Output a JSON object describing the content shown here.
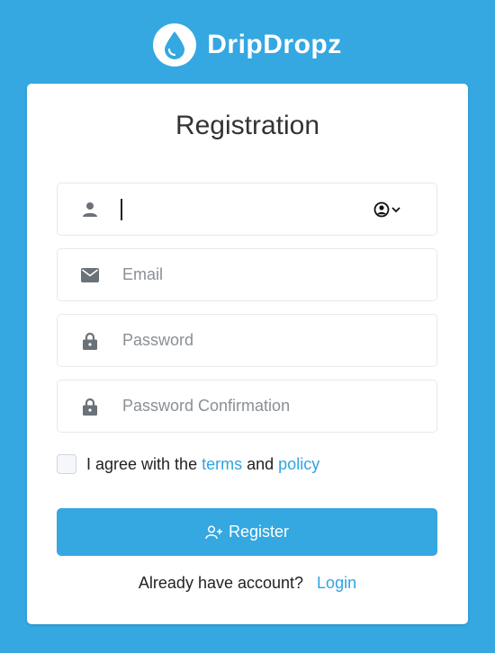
{
  "brand": {
    "name": "DripDropz"
  },
  "card": {
    "title": "Registration",
    "username": {
      "value": "",
      "placeholder": ""
    },
    "email": {
      "placeholder": "Email"
    },
    "password": {
      "placeholder": "Password"
    },
    "password_confirmation": {
      "placeholder": "Password Confirmation"
    },
    "agree": {
      "prefix": "I agree with the",
      "terms": "terms",
      "and": "and",
      "policy": "policy",
      "checked": false
    },
    "register_label": "Register",
    "login_prompt": "Already have account?",
    "login_link": "Login"
  },
  "colors": {
    "background": "#35a7e1",
    "accent": "#35a7e1",
    "link": "#2fa4e0",
    "icon": "#6b7178"
  },
  "icons": {
    "brand": "water-drop-icon",
    "username": "user-icon",
    "email": "envelope-icon",
    "password": "lock-icon",
    "avatar_select": "user-circle-icon",
    "register": "user-plus-icon"
  }
}
